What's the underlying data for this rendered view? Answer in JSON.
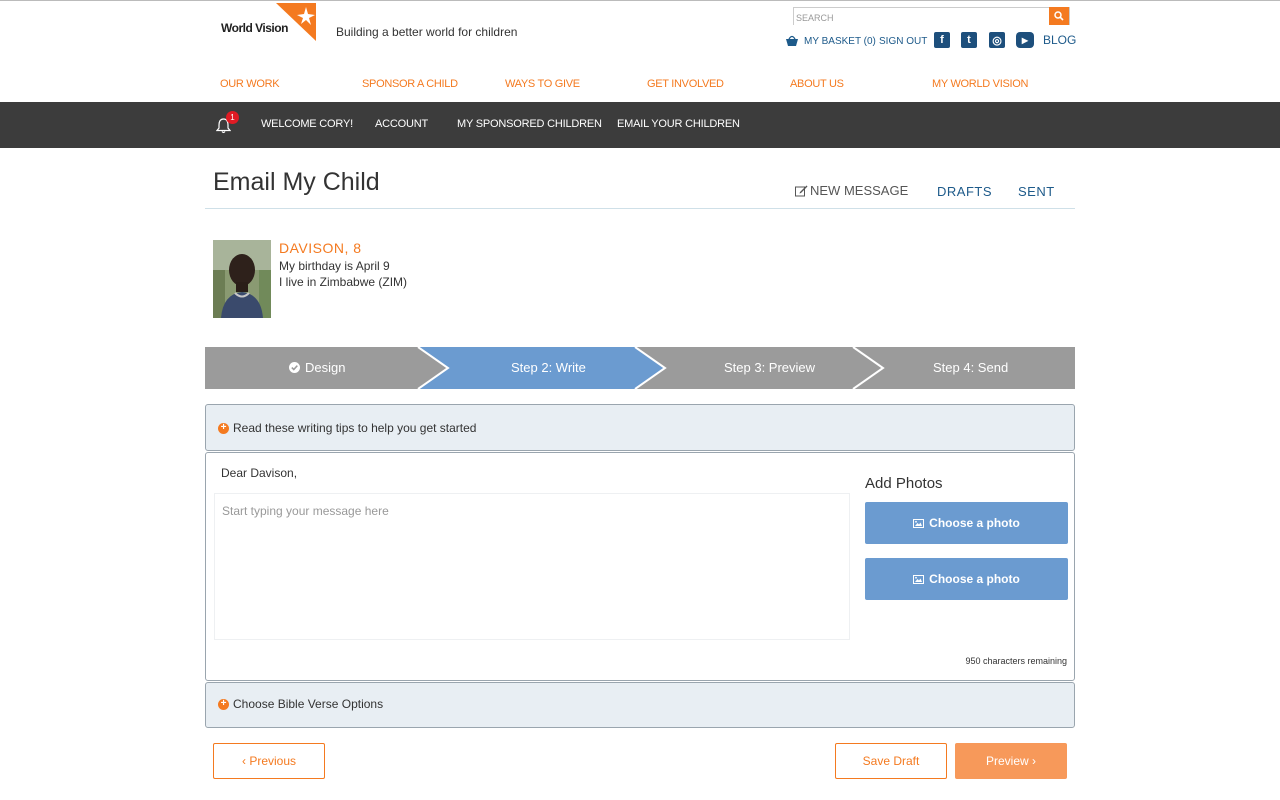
{
  "header": {
    "logo_text": "World Vision",
    "tagline": "Building a better world for children",
    "search": {
      "placeholder": "SEARCH",
      "icon": "search-icon"
    },
    "basket_label": "MY BASKET (0)",
    "signout_label": "SIGN OUT",
    "social": [
      {
        "name": "facebook",
        "glyph": "f"
      },
      {
        "name": "twitter",
        "glyph": "t"
      },
      {
        "name": "instagram",
        "glyph": "◎"
      },
      {
        "name": "youtube",
        "glyph": "▶"
      }
    ],
    "blog_label": "BLOG"
  },
  "main_nav": [
    "OUR WORK",
    "SPONSOR A CHILD",
    "WAYS TO GIVE",
    "GET INVOLVED",
    "ABOUT US",
    "MY WORLD VISION"
  ],
  "account_nav": {
    "notification_count": "1",
    "items": [
      "WELCOME CORY!",
      "ACCOUNT",
      "MY SPONSORED CHILDREN",
      "EMAIL YOUR CHILDREN"
    ]
  },
  "page": {
    "title": "Email My Child",
    "tabs": {
      "new_message": "NEW MESSAGE",
      "drafts": "DRAFTS",
      "sent": "SENT"
    }
  },
  "child": {
    "name": "DAVISON, 8",
    "birthday": "My birthday is April 9",
    "location": "I live in Zimbabwe (ZIM)"
  },
  "steps": [
    {
      "label": "Design",
      "state": "complete"
    },
    {
      "label": "Step 2: Write",
      "state": "active"
    },
    {
      "label": "Step 3: Preview",
      "state": "upcoming"
    },
    {
      "label": "Step 4: Send",
      "state": "upcoming"
    }
  ],
  "tips_label": "Read these writing tips to help you get started",
  "compose": {
    "greeting": "Dear Davison,",
    "message_placeholder": "Start typing your message here",
    "add_photos_title": "Add Photos",
    "photo_button_1": "Choose a photo",
    "photo_button_2": "Choose a photo",
    "chars_remaining": "950 characters remaining"
  },
  "bible_label": "Choose Bible Verse Options",
  "buttons": {
    "previous": "‹ Previous",
    "save_draft": "Save Draft",
    "preview": "Preview ›"
  },
  "colors": {
    "accent_orange": "#f47a20",
    "active_step_blue": "#6b9bd0",
    "step_gray": "#9b9b9b",
    "dark_bar": "#3c3c3c",
    "link_blue": "#1d5a8a"
  }
}
